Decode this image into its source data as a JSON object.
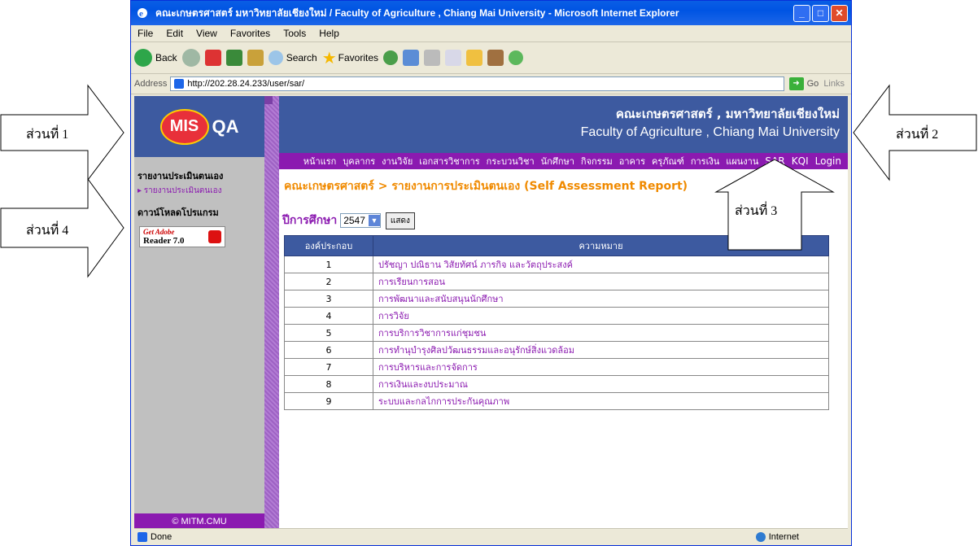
{
  "window": {
    "title": "คณะเกษตรศาสตร์ มหาวิทยาลัยเชียงใหม่ / Faculty of Agriculture , Chiang Mai University   - Microsoft Internet Explorer"
  },
  "menu": [
    "File",
    "Edit",
    "View",
    "Favorites",
    "Tools",
    "Help"
  ],
  "toolbar": {
    "back": "Back",
    "search": "Search",
    "favorites": "Favorites"
  },
  "address": {
    "label": "Address",
    "url": "http://202.28.24.233/user/sar/",
    "go": "Go",
    "links": "Links"
  },
  "status": {
    "left": "Done",
    "right": "Internet"
  },
  "sidebar": {
    "heading1": "รายงานประเมินตนเอง",
    "link1": "▸ รายงานประเมินตนเอง",
    "heading2": "ดาวน์โหลดโปรแกรม",
    "adobe_get": "Get Adobe",
    "adobe_reader": "Reader 7.0",
    "footer": "© MITM.CMU",
    "logo_mis": "MIS",
    "logo_qa": "QA"
  },
  "banner": {
    "thai": "คณะเกษตรศาสตร์ , มหาวิทยาลัยเชียงใหม่",
    "english": "Faculty of Agriculture , Chiang Mai University"
  },
  "nav": [
    "หน้าแรก",
    "บุคลากร",
    "งานวิจัย",
    "เอกสารวิชาการ",
    "กระบวนวิชา",
    "นักศึกษา",
    "กิจกรรม",
    "อาคาร",
    "ครุภัณฑ์",
    "การเงิน",
    "แผนงาน",
    "SAR",
    "KQI",
    "Login"
  ],
  "breadcrumb": "คณะเกษตรศาสตร์ > รายงานการประเมินตนเอง (Self Assessment Report)",
  "year": {
    "label": "ปีการศึกษา",
    "value": "2547",
    "button": "แสดง"
  },
  "table": {
    "headers": [
      "องค์ประกอบ",
      "ความหมาย"
    ],
    "rows": [
      [
        "1",
        "ปรัชญา ปณิธาน วิสัยทัศน์ ภารกิจ และวัตถุประสงค์"
      ],
      [
        "2",
        "การเรียนการสอน"
      ],
      [
        "3",
        "การพัฒนาและสนับสนุนนักศึกษา"
      ],
      [
        "4",
        "การวิจัย"
      ],
      [
        "5",
        "การบริการวิชาการแก่ชุมชน"
      ],
      [
        "6",
        "การทำนุบำรุงศิลปวัฒนธรรมและอนุรักษ์สิ่งแวดล้อม"
      ],
      [
        "7",
        "การบริหารและการจัดการ"
      ],
      [
        "8",
        "การเงินและงบประมาณ"
      ],
      [
        "9",
        "ระบบและกลไกการประกันคุณภาพ"
      ]
    ]
  },
  "annotations": {
    "part1": "ส่วนที่ 1",
    "part2": "ส่วนที่ 2",
    "part3": "ส่วนที่ 3",
    "part4": "ส่วนที่ 4"
  },
  "colors": {
    "purple": "#8b1ab0",
    "blue": "#3d5aa0",
    "orange": "#f08a00"
  }
}
